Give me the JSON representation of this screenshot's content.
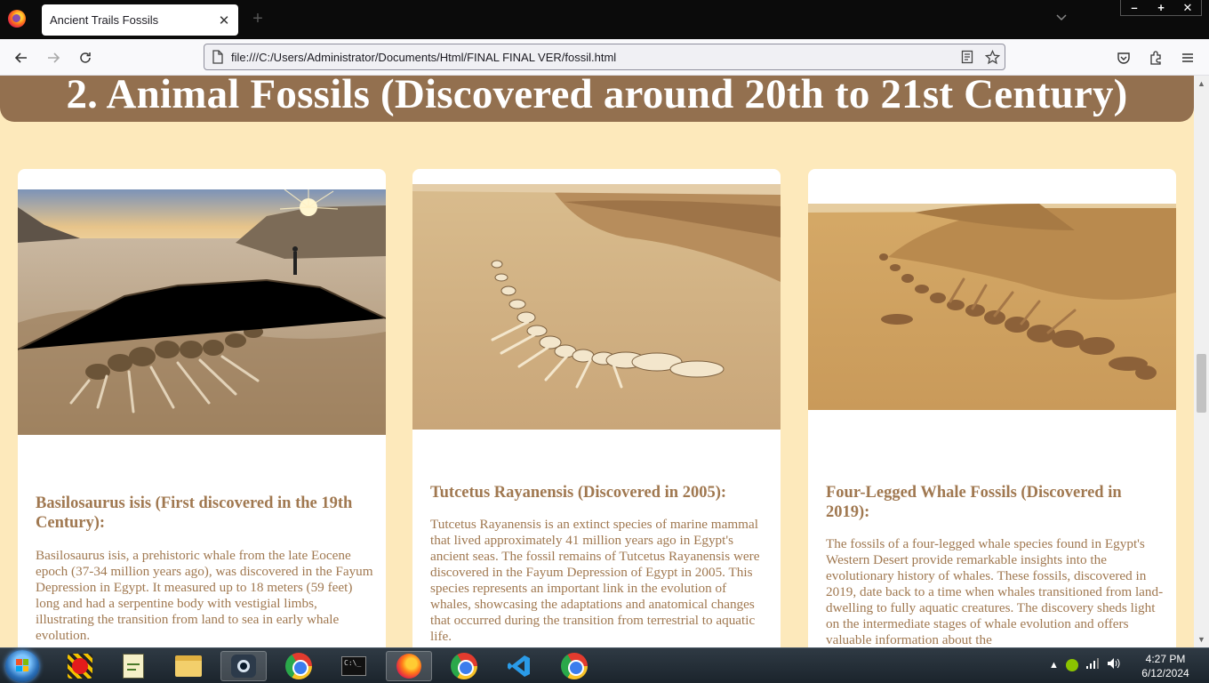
{
  "browser": {
    "tab_title": "Ancient Trails Fossils",
    "tab_close": "✕",
    "new_tab": "+",
    "url": "file:///C:/Users/Administrator/Documents/Html/FINAL FINAL VER/fossil.html",
    "window_minimize": "–",
    "window_maximize": "+",
    "window_close": "✕"
  },
  "page": {
    "section_title": "2. Animal Fossils (Discovered around 20th to 21st Century)",
    "cards": [
      {
        "title": "Basilosaurus isis (First discovered in the 19th Century):",
        "text": "Basilosaurus isis, a prehistoric whale from the late Eocene epoch (37-34 million years ago), was discovered in the Fayum Depression in Egypt. It measured up to 18 meters (59 feet) long and had a serpentine body with vestigial limbs, illustrating the transition from land to sea in early whale evolution."
      },
      {
        "title": "Tutcetus Rayanensis (Discovered in 2005):",
        "text": "Tutcetus Rayanensis is an extinct species of marine mammal that lived approximately 41 million years ago in Egypt's ancient seas. The fossil remains of Tutcetus Rayanensis were discovered in the Fayum Depression of Egypt in 2005. This species represents an important link in the evolution of whales, showcasing the adaptations and anatomical changes that occurred during the transition from terrestrial to aquatic life."
      },
      {
        "title": "Four-Legged Whale Fossils (Discovered in 2019):",
        "text": "The fossils of a four-legged whale species found in Egypt's Western Desert provide remarkable insights into the evolutionary history of whales. These fossils, discovered in 2019, date back to a time when whales transitioned from land-dwelling to fully aquatic creatures. The discovery sheds light on the intermediate stages of whale evolution and offers valuable information about the"
      }
    ]
  },
  "taskbar": {
    "time": "4:27 PM",
    "date": "6/12/2024"
  },
  "colors": {
    "page_bg": "#fde9bb",
    "header_bg": "#93704f",
    "card_text": "#a07850"
  }
}
